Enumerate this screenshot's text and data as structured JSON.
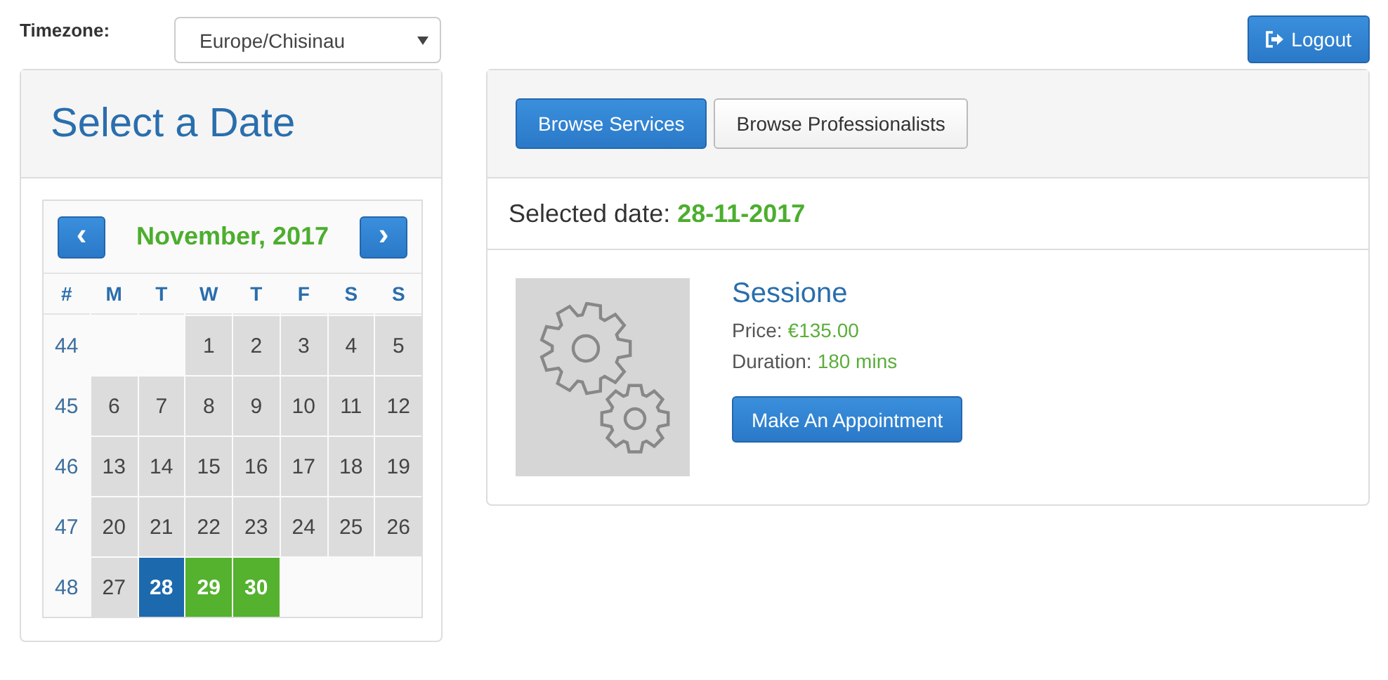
{
  "timezone": {
    "label": "Timezone:",
    "value": "Europe/Chisinau"
  },
  "logout": {
    "label": "Logout"
  },
  "calendar_panel": {
    "title": "Select a Date",
    "month": "November, 2017",
    "prev": "‹",
    "next": "›",
    "weekday_headers": [
      "#",
      "M",
      "T",
      "W",
      "T",
      "F",
      "S",
      "S"
    ],
    "weeks": [
      {
        "number": "44",
        "days": [
          {
            "kind": "empty"
          },
          {
            "kind": "empty"
          },
          {
            "kind": "past",
            "day": "1"
          },
          {
            "kind": "past",
            "day": "2"
          },
          {
            "kind": "past",
            "day": "3"
          },
          {
            "kind": "past",
            "day": "4"
          },
          {
            "kind": "past",
            "day": "5"
          }
        ]
      },
      {
        "number": "45",
        "days": [
          {
            "kind": "past",
            "day": "6"
          },
          {
            "kind": "past",
            "day": "7"
          },
          {
            "kind": "past",
            "day": "8"
          },
          {
            "kind": "past",
            "day": "9"
          },
          {
            "kind": "past",
            "day": "10"
          },
          {
            "kind": "past",
            "day": "11"
          },
          {
            "kind": "past",
            "day": "12"
          }
        ]
      },
      {
        "number": "46",
        "days": [
          {
            "kind": "past",
            "day": "13"
          },
          {
            "kind": "past",
            "day": "14"
          },
          {
            "kind": "past",
            "day": "15"
          },
          {
            "kind": "past",
            "day": "16"
          },
          {
            "kind": "past",
            "day": "17"
          },
          {
            "kind": "past",
            "day": "18"
          },
          {
            "kind": "past",
            "day": "19"
          }
        ]
      },
      {
        "number": "47",
        "days": [
          {
            "kind": "past",
            "day": "20"
          },
          {
            "kind": "past",
            "day": "21"
          },
          {
            "kind": "past",
            "day": "22"
          },
          {
            "kind": "past",
            "day": "23"
          },
          {
            "kind": "past",
            "day": "24"
          },
          {
            "kind": "past",
            "day": "25"
          },
          {
            "kind": "past",
            "day": "26"
          }
        ]
      },
      {
        "number": "48",
        "days": [
          {
            "kind": "past",
            "day": "27"
          },
          {
            "kind": "selected",
            "day": "28"
          },
          {
            "kind": "available",
            "day": "29"
          },
          {
            "kind": "available",
            "day": "30"
          },
          {
            "kind": "empty"
          },
          {
            "kind": "empty"
          },
          {
            "kind": "empty"
          }
        ]
      }
    ]
  },
  "services_panel": {
    "tabs": [
      {
        "label": "Browse Services",
        "selected": true
      },
      {
        "label": "Browse Professionalists",
        "selected": false
      }
    ],
    "selected_date_label": "Selected date:",
    "selected_date": "28-11-2017",
    "services": [
      {
        "name": "Sessione",
        "price_label": "Price:",
        "price": "€135.00",
        "duration_label": "Duration:",
        "duration": "180 mins",
        "action": "Make An Appointment"
      }
    ]
  }
}
